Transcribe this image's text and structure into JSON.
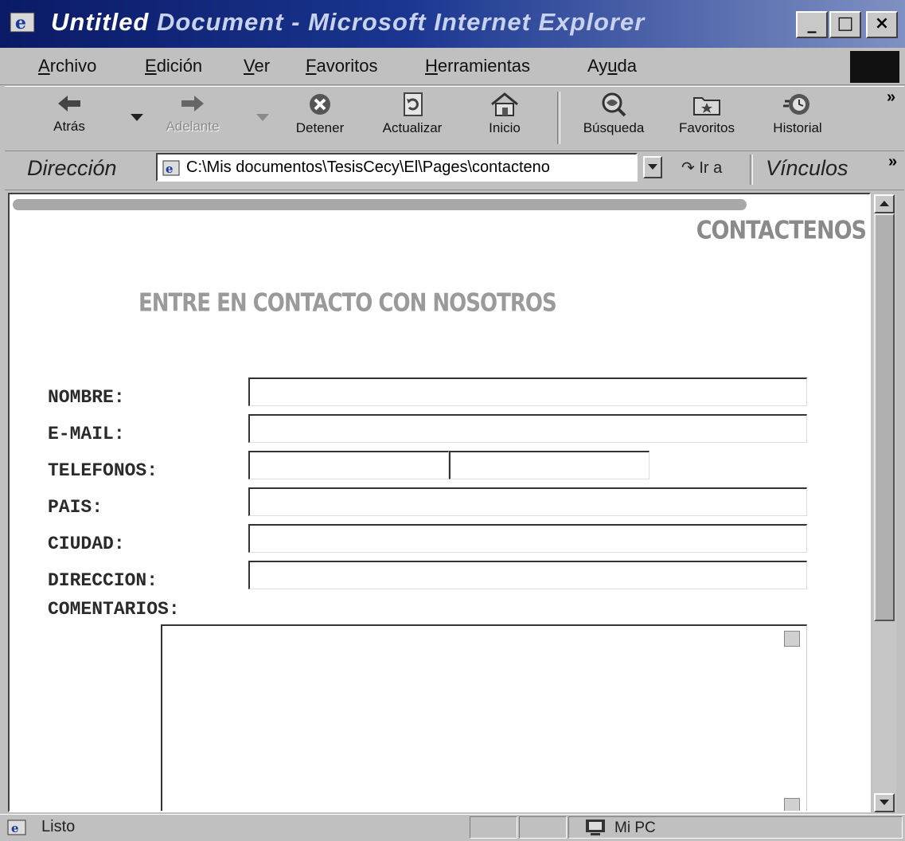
{
  "window": {
    "title_part1": "Untitled",
    "title_part2": " Document - Microsoft Internet Explorer",
    "minimize_glyph": "_",
    "maximize_glyph": "□",
    "close_glyph": "×"
  },
  "menu": {
    "items": [
      {
        "label": "Archivo",
        "accel": "A"
      },
      {
        "label": "Edición",
        "accel": "E"
      },
      {
        "label": "Ver",
        "accel": "V"
      },
      {
        "label": "Favoritos",
        "accel": "F"
      },
      {
        "label": "Herramientas",
        "accel": "H"
      },
      {
        "label": "Ayuda",
        "accel": "u"
      }
    ]
  },
  "toolbar": {
    "back": "Atrás",
    "forward": "Adelante",
    "stop": "Detener",
    "refresh": "Actualizar",
    "home": "Inicio",
    "search": "Búsqueda",
    "favorites": "Favoritos",
    "history": "Historial",
    "more": "»"
  },
  "address": {
    "label": "Dirección",
    "value": "C:\\Mis documentos\\TesisCecy\\El\\Pages\\contacteno",
    "go": "Ir a",
    "links": "Vínculos",
    "more": "»"
  },
  "page": {
    "section_label": "CONTACTENOS",
    "heading": "ENTRE EN CONTACTO CON NOSOTROS",
    "fields": {
      "nombre": "NOMBRE:",
      "email": "E-MAIL:",
      "telefonos": "TELEFONOS:",
      "pais": "PAIS:",
      "ciudad": "CIUDAD:",
      "direccion": "DIRECCION:",
      "comentarios": "COMENTARIOS:"
    }
  },
  "status": {
    "text": "Listo",
    "zone": "Mi PC"
  },
  "colors": {
    "titlebar_dark": "#0a1a66",
    "titlebar_light": "#7f90c2",
    "chrome": "#c0c0c0",
    "heading_gray": "#9a9a9a"
  }
}
